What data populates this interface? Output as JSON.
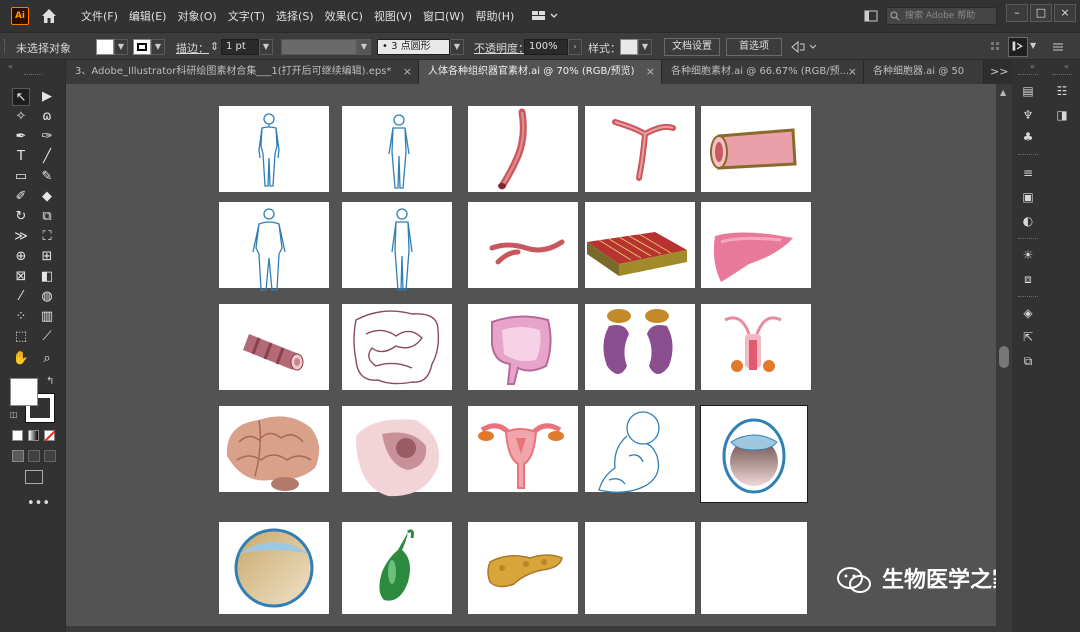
{
  "menubar": {
    "logo": "Ai",
    "items": [
      "文件(F)",
      "编辑(E)",
      "对象(O)",
      "文字(T)",
      "选择(S)",
      "效果(C)",
      "视图(V)",
      "窗口(W)",
      "帮助(H)"
    ],
    "search_placeholder": "搜索 Adobe 帮助",
    "window_buttons": [
      "–",
      "□",
      "×"
    ]
  },
  "ctrlbar": {
    "selection_status": "未选择对象",
    "stroke_label": "描边：",
    "stroke_value": "1 pt",
    "brush_value": "• 3 点圆形",
    "opacity_label": "不透明度：",
    "opacity_value": "100%",
    "style_label": "样式：",
    "doc_setup_button": "文档设置",
    "prefs_button": "首选项"
  },
  "tabs": [
    {
      "label": "3、Adobe_Illustrator科研绘图素材合集___1(打开后可继续编辑).eps*",
      "active": false
    },
    {
      "label": "人体各种组织器官素材.ai @ 70% (RGB/预览)",
      "active": true
    },
    {
      "label": "各种细胞素材.ai @ 66.67% (RGB/预...",
      "active": false
    },
    {
      "label": "各种细胞器.ai @ 50",
      "active": false
    }
  ],
  "tab_overflow": ">>",
  "watermark": "生物医学之家",
  "colors": {
    "outline_blue": "#2f7fb6",
    "vessel_red": "#c9575e",
    "organ_pink": "#e9799a",
    "brain_tan": "#d9a08a",
    "gallbladder_green": "#2c8a3e",
    "pancreas_yellow": "#d8a53a",
    "ui_dark": "#323232",
    "canvas_gray": "#535353"
  }
}
